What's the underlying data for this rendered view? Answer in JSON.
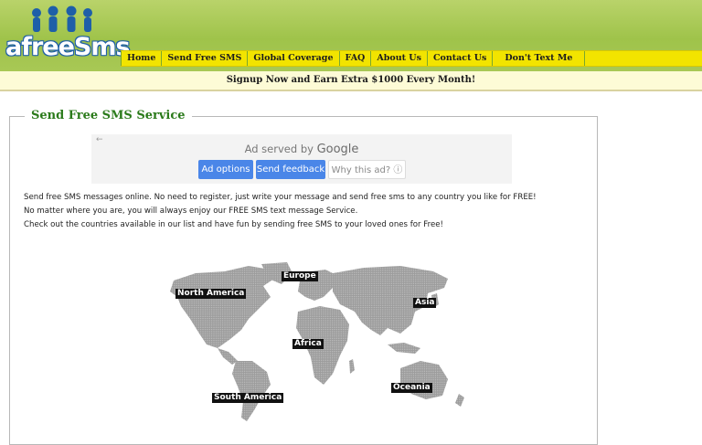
{
  "header": {
    "logo_text": "afreeSms",
    "brand_color": "#1e5fa8",
    "nav": [
      {
        "label": "Home"
      },
      {
        "label": "Send Free SMS"
      },
      {
        "label": "Global Coverage"
      },
      {
        "label": "FAQ"
      },
      {
        "label": "About Us"
      },
      {
        "label": "Contact Us"
      },
      {
        "label": "Don't Text Me"
      }
    ]
  },
  "promo": {
    "text": "Signup Now and Earn Extra $1000 Every Month!"
  },
  "panel": {
    "title": "Send Free SMS Service"
  },
  "ad": {
    "back_icon": "arrow-left-icon",
    "served_prefix": "Ad served by",
    "served_brand": "Google",
    "options_label": "Ad options",
    "feedback_label": "Send feedback",
    "why_label": "Why this ad? ⓘ"
  },
  "description": [
    "Send free SMS messages online. No need to register, just write your message and send free sms to any country you like for FREE!",
    "No matter where you are, you will always enjoy our FREE SMS text message Service.",
    "Check out the countries available in our list and have fun by sending free SMS to your loved ones for Free!"
  ],
  "map": {
    "regions": [
      {
        "label": "North America"
      },
      {
        "label": "Europe"
      },
      {
        "label": "Asia"
      },
      {
        "label": "Africa"
      },
      {
        "label": "Oceania"
      },
      {
        "label": "South America"
      }
    ]
  }
}
